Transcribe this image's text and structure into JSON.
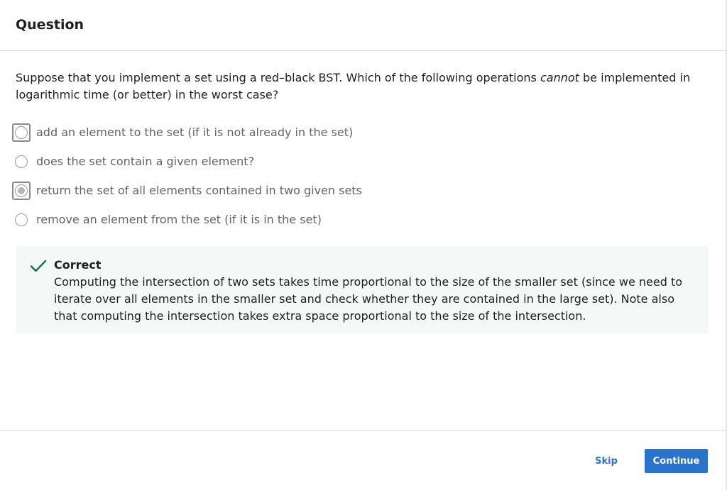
{
  "header": {
    "title": "Question"
  },
  "question": {
    "text_before": "Suppose that you implement a set using a red–black BST. Which of the following operations ",
    "text_emphasis": "cannot",
    "text_after": " be implemented in logarithmic time (or better) in the worst case?"
  },
  "options": [
    {
      "label": "add an element to the set (if it is not already in the set)",
      "selected": false,
      "focused": true
    },
    {
      "label": "does the set contain a given element?",
      "selected": false,
      "focused": false
    },
    {
      "label": "return the set of all elements contained in two given sets",
      "selected": true,
      "focused": true
    },
    {
      "label": "remove an element from the set (if it is in the set)",
      "selected": false,
      "focused": false
    }
  ],
  "feedback": {
    "icon": "check-icon",
    "title": "Correct",
    "text": "Computing the intersection of two sets takes time proportional to the size of the smaller set (since we need to iterate over all elements in the smaller set and check whether they are contained in the large set). Note also that computing the intersection takes extra space proportional to the size of the intersection.",
    "icon_color": "#1e7a4e"
  },
  "footer": {
    "skip_label": "Skip",
    "continue_label": "Continue"
  },
  "colors": {
    "accent": "#2a73cc",
    "feedback_bg": "#f4f8f6"
  }
}
